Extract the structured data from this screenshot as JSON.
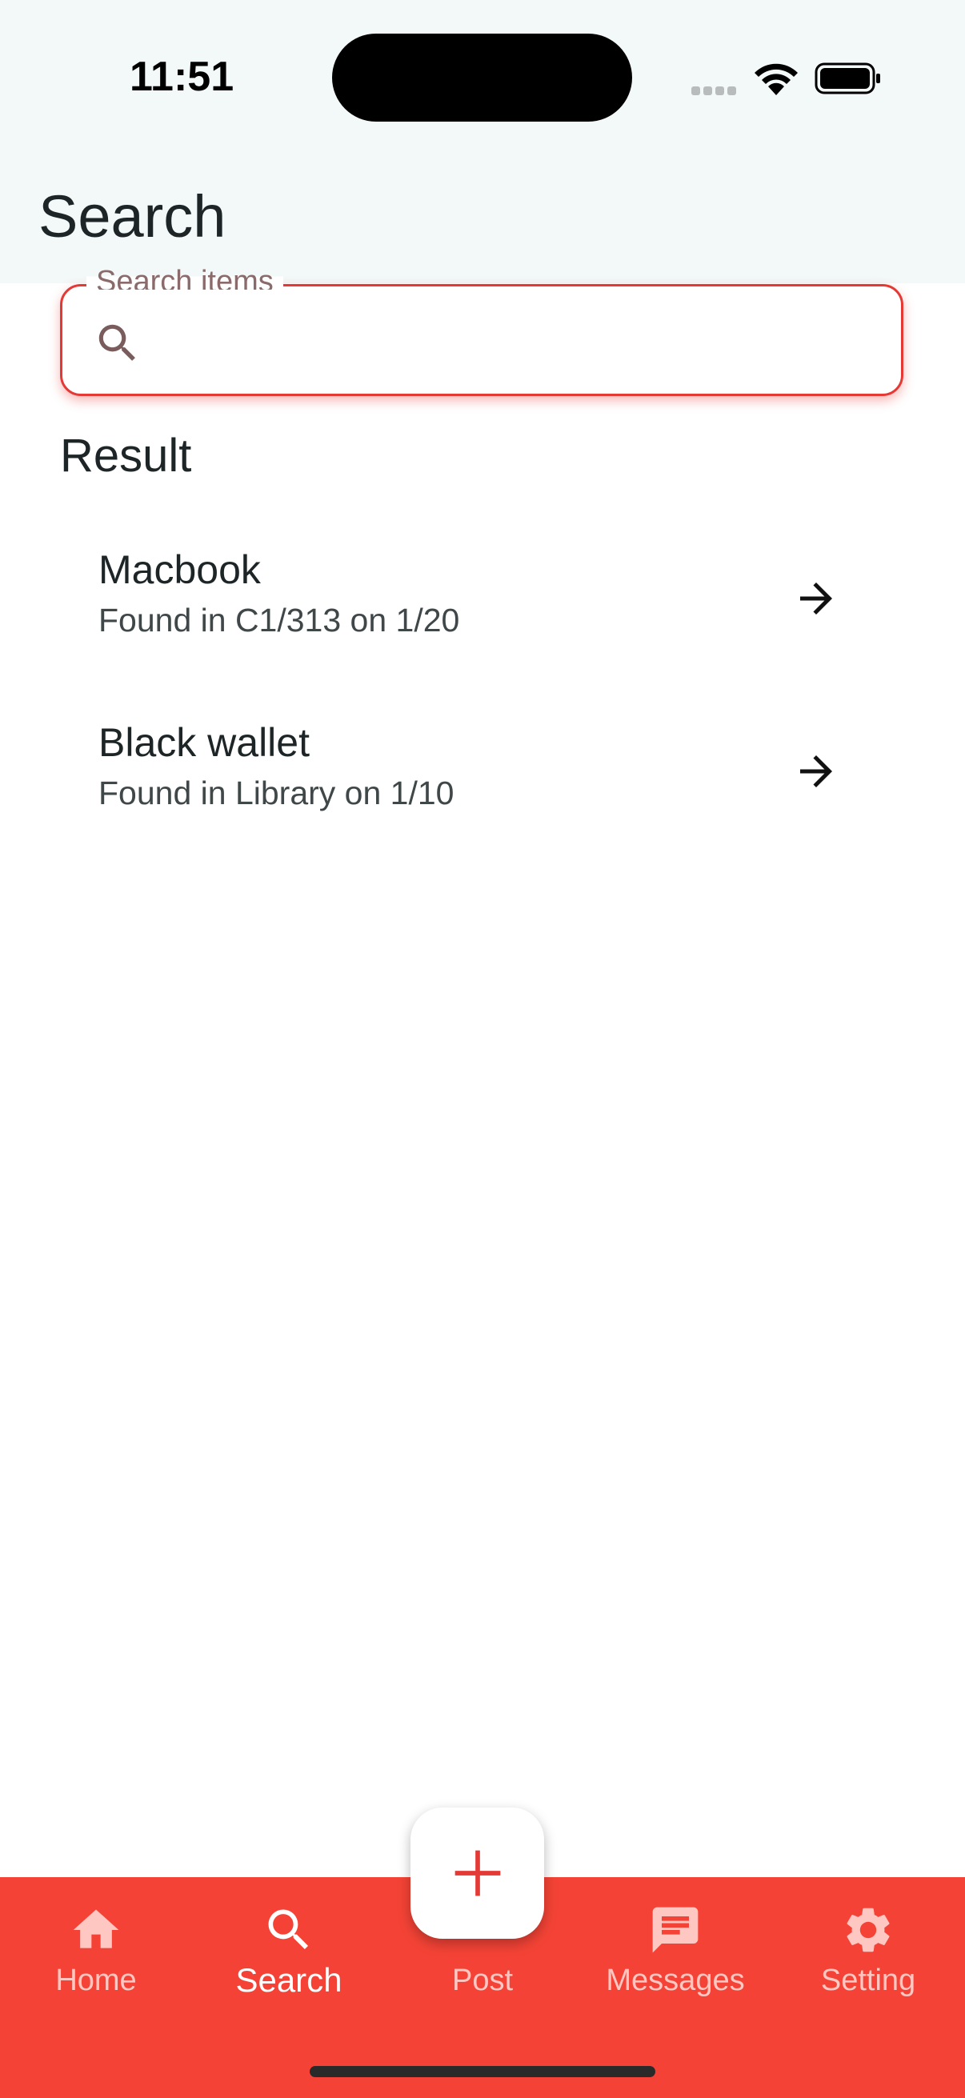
{
  "status_bar": {
    "time": "11:51"
  },
  "header": {
    "title": "Search"
  },
  "search": {
    "legend": "Search items",
    "value": "",
    "placeholder": ""
  },
  "results": {
    "heading": "Result",
    "items": [
      {
        "title": "Macbook",
        "subtitle": "Found in C1/313 on 1/20"
      },
      {
        "title": "Black wallet",
        "subtitle": "Found in Library on 1/10"
      }
    ]
  },
  "bottom_nav": {
    "items": [
      {
        "label": "Home",
        "icon": "home-icon"
      },
      {
        "label": "Search",
        "icon": "search-icon",
        "active": true
      },
      {
        "label": "Post",
        "icon": "plus-icon"
      },
      {
        "label": "Messages",
        "icon": "message-icon"
      },
      {
        "label": "Setting",
        "icon": "gear-icon"
      }
    ]
  },
  "colors": {
    "accent": "#f44336",
    "field_border": "#e53935",
    "header_bg": "#f3f8f8",
    "text": "#1d2527"
  }
}
